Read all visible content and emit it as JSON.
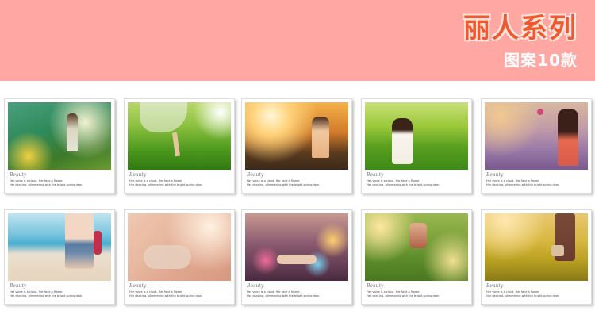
{
  "header": {
    "title": "丽人系列",
    "subtitle": "图案10款"
  },
  "cards": [
    {
      "caption_title": "Beauty",
      "caption_line1": "Her voice is a cloud. Her face a flower.",
      "caption_line2": "Her dancing, glimmering with the bright spring dew."
    },
    {
      "caption_title": "Beauty",
      "caption_line1": "Her voice is a cloud. Her face a flower.",
      "caption_line2": "Her dancing, glimmering with the bright spring dew."
    },
    {
      "caption_title": "Beauty",
      "caption_line1": "Her voice is a cloud. Her face a flower.",
      "caption_line2": "Her dancing, glimmering with the bright spring dew."
    },
    {
      "caption_title": "Beauty",
      "caption_line1": "Her voice is a cloud. Her face a flower.",
      "caption_line2": "Her dancing, glimmering with the bright spring dew."
    },
    {
      "caption_title": "Beauty",
      "caption_line1": "Her voice is a cloud. Her face a flower.",
      "caption_line2": "Her dancing, glimmering with the bright spring dew."
    },
    {
      "caption_title": "Beauty",
      "caption_line1": "Her voice is a cloud. Her face a flower.",
      "caption_line2": "Her dancing, glimmering with the bright spring dew."
    },
    {
      "caption_title": "Beauty",
      "caption_line1": "Her voice is a cloud. Her face a flower.",
      "caption_line2": "Her dancing, glimmering with the bright spring dew."
    },
    {
      "caption_title": "Beauty",
      "caption_line1": "Her voice is a cloud. Her face a flower.",
      "caption_line2": "Her dancing, glimmering with the bright spring dew."
    },
    {
      "caption_title": "Beauty",
      "caption_line1": "Her voice is a cloud. Her face a flower.",
      "caption_line2": "Her dancing, glimmering with the bright spring dew."
    },
    {
      "caption_title": "Beauty",
      "caption_line1": "Her voice is a cloud. Her face a flower.",
      "caption_line2": "Her dancing, glimmering with the bright spring dew."
    }
  ]
}
